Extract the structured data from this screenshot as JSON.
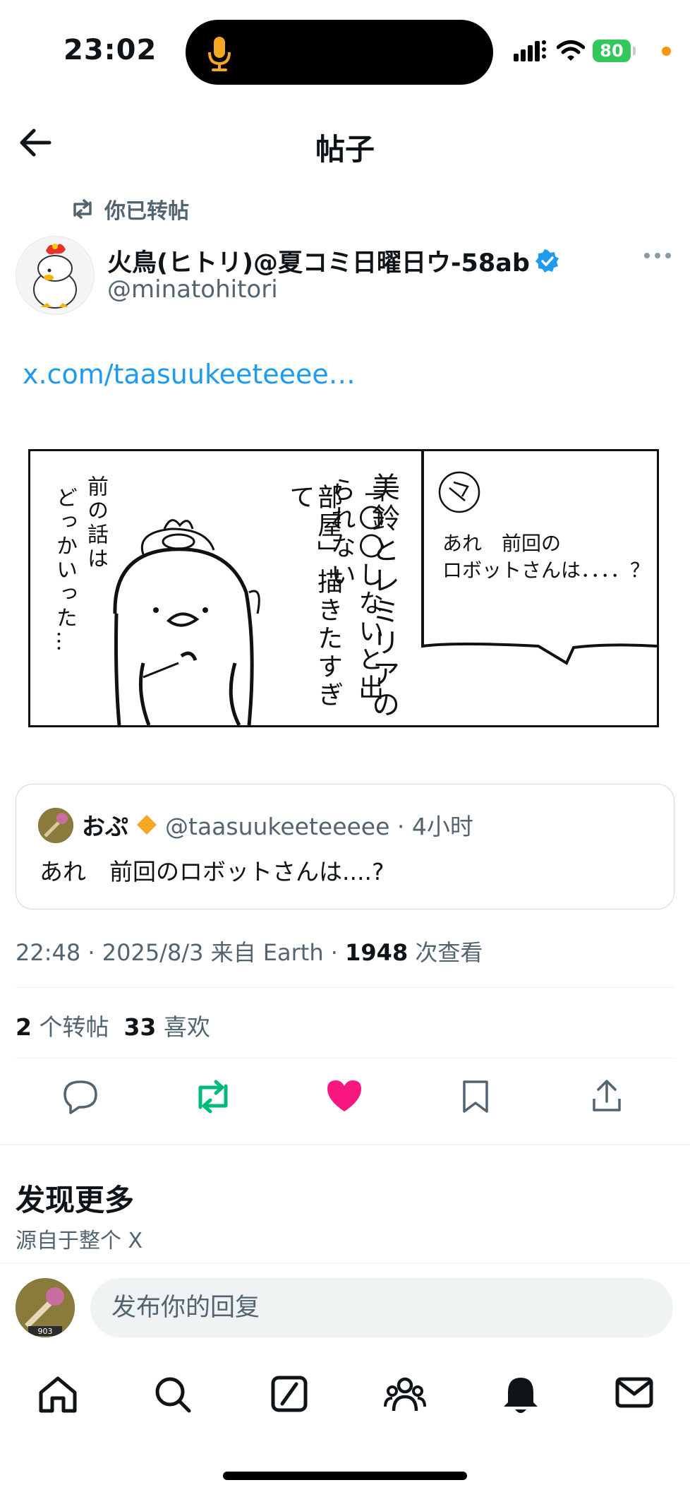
{
  "status_bar": {
    "time": "23:02",
    "battery": "80"
  },
  "header": {
    "title": "帖子"
  },
  "post": {
    "repost_label": "你已转帖",
    "author_name": "火鳥(ヒトリ)@夏コミ日曜日ウ-58ab",
    "author_handle": "@minatohitori",
    "link_text": "x.com/taasuukeeteeee…",
    "comic": {
      "bubble_line1": "あれ　前回の",
      "bubble_line2": "ロボットさんは．．．．？",
      "vertical_col1": "美鈴とレミリアの",
      "vertical_col2": "「〇〇しないと出られない",
      "vertical_col3": "部屋」描きたすぎて",
      "vertical_col4": "前の話は",
      "vertical_col5": "どっかいった…"
    },
    "quote": {
      "name": "おぷ",
      "handle_time": "@taasuukeeteeeee · 4小时",
      "text": "あれ　前回のロボットさんは....?",
      "avatar_label": "903"
    },
    "meta": {
      "time_date": "22:48 · 2025/8/3 来自 Earth · ",
      "views": "1948",
      "views_label": " 次查看"
    },
    "stats": {
      "reposts": "2",
      "reposts_label": " 个转帖",
      "likes": "33",
      "likes_label": " 喜欢"
    }
  },
  "discover": {
    "title": "发现更多",
    "subtitle": "源自于整个 X"
  },
  "reply": {
    "placeholder": "发布你的回复",
    "avatar_label": "903"
  },
  "colors": {
    "accent": "#1d9bf0",
    "repost_green": "#00ba7c",
    "like_pink": "#f91880",
    "verified": "#1d9bf0"
  },
  "icons": [
    "mic-icon",
    "signal-icon",
    "wifi-icon",
    "back-arrow-icon",
    "repost-icon",
    "verified-badge-icon",
    "more-icon",
    "reply-icon",
    "like-icon",
    "bookmark-icon",
    "share-icon",
    "home-icon",
    "search-icon",
    "grok-icon",
    "communities-icon",
    "notifications-icon",
    "messages-icon"
  ]
}
